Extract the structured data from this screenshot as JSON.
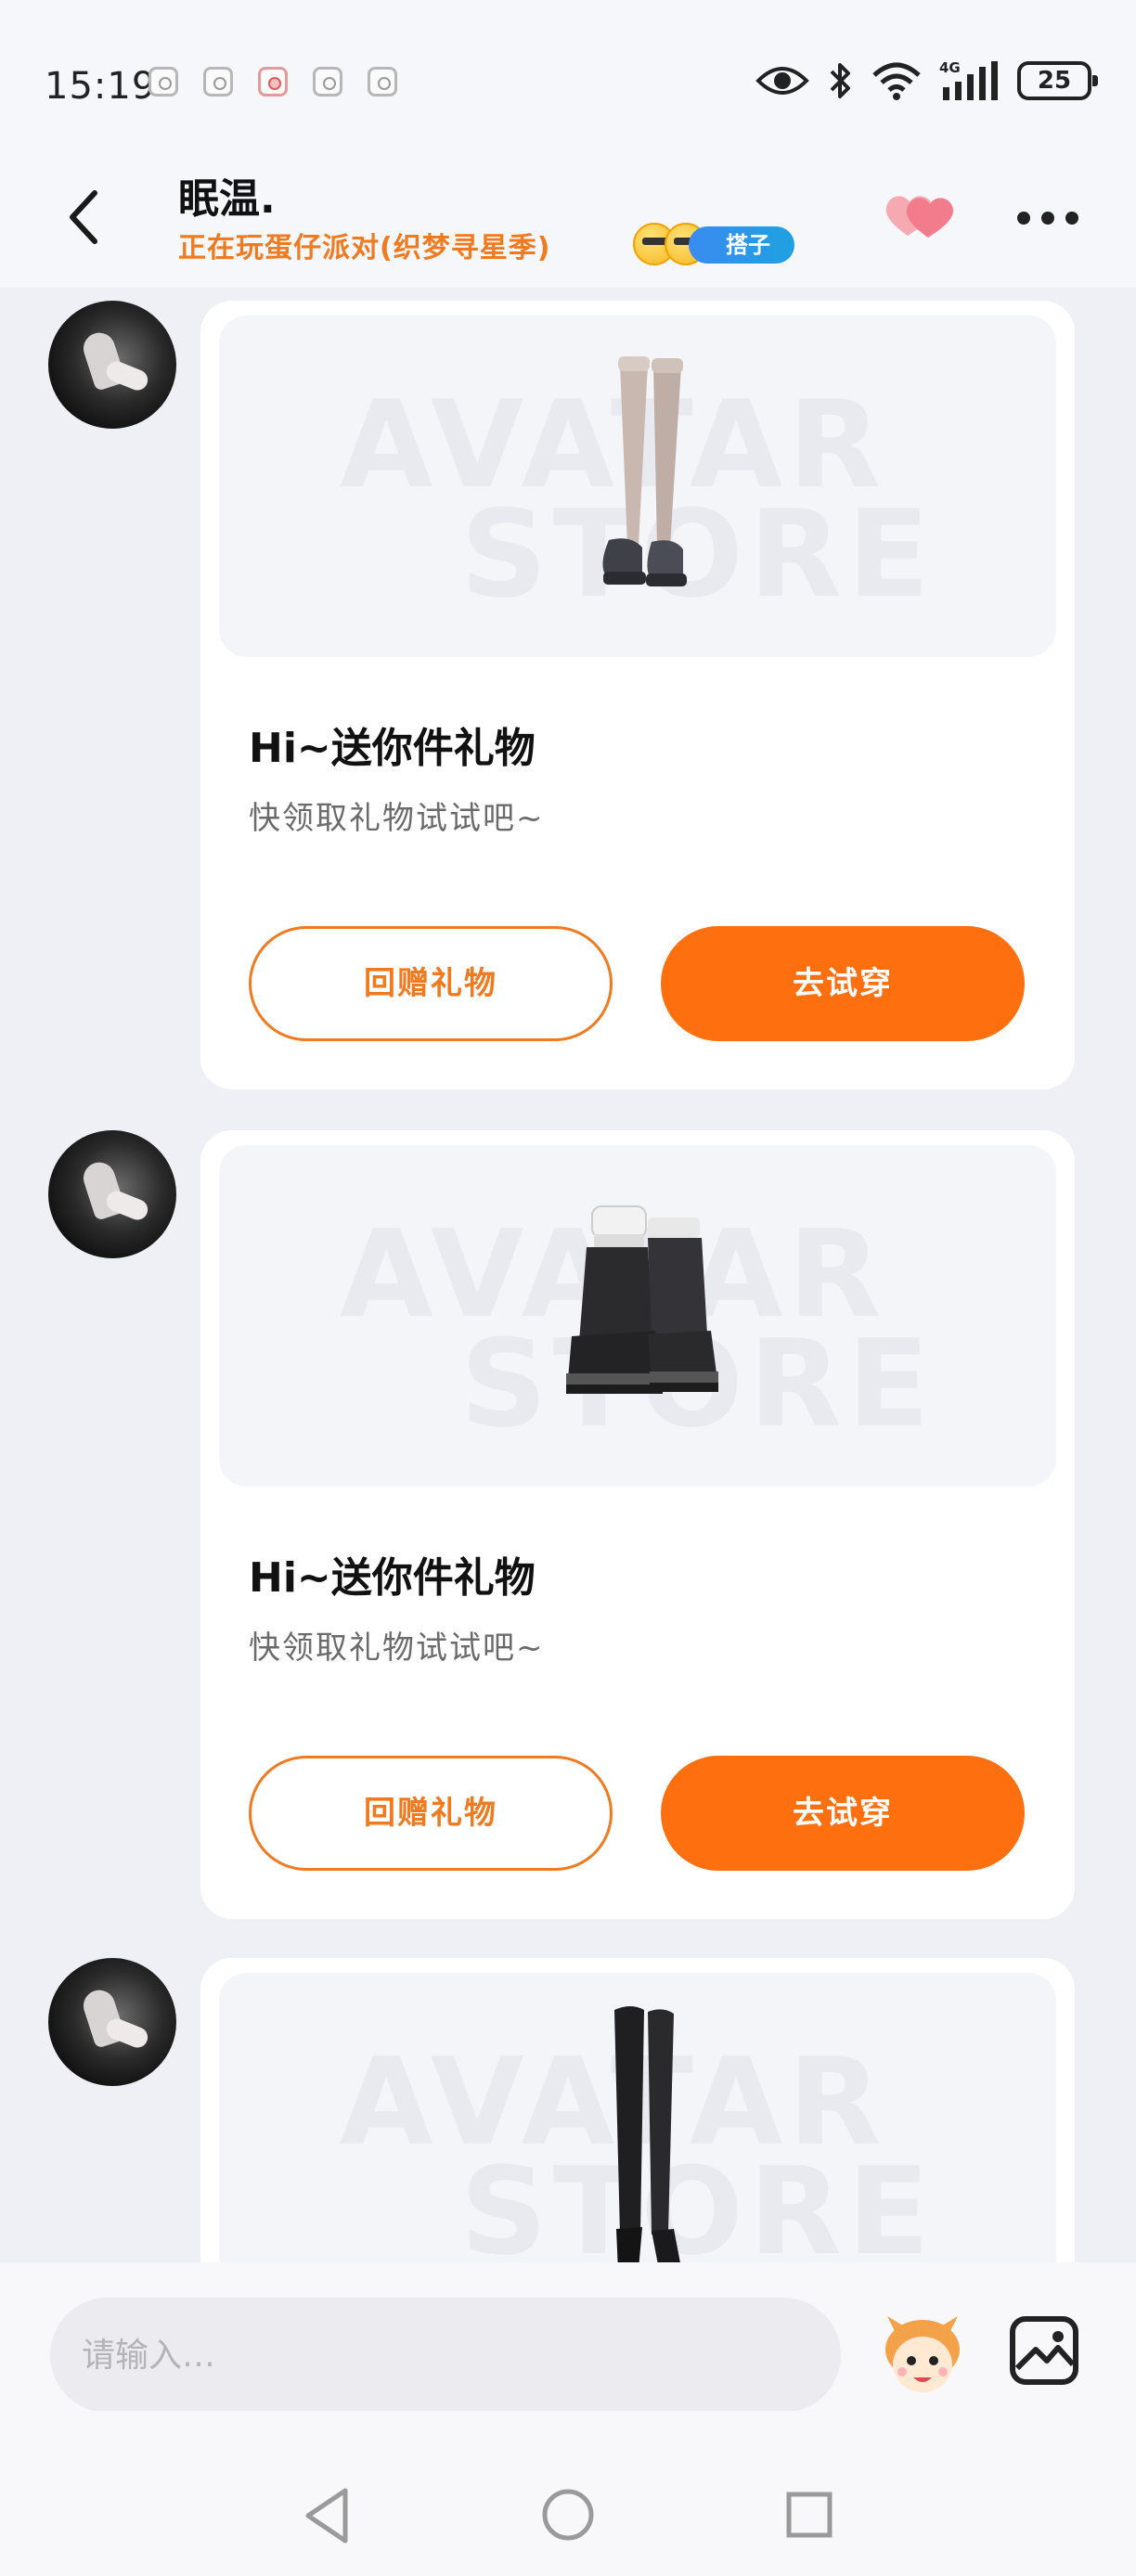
{
  "status_bar": {
    "time": "15:19",
    "network": "4G",
    "battery": "25"
  },
  "header": {
    "name": "眠温.",
    "status": "正在玩蛋仔派对(织梦寻星季)",
    "partner_badge": "搭子"
  },
  "messages": [
    {
      "item": "stockings-shoes",
      "watermark_line1": "AVATAR",
      "watermark_line2": "STORE",
      "title": "Hi~送你件礼物",
      "subtitle": "快领取礼物试试吧~",
      "return_label": "回赠礼物",
      "tryon_label": "去试穿"
    },
    {
      "item": "black-platform-boots",
      "watermark_line1": "AVATAR",
      "watermark_line2": "STORE",
      "title": "Hi~送你件礼物",
      "subtitle": "快领取礼物试试吧~",
      "return_label": "回赠礼物",
      "tryon_label": "去试穿"
    },
    {
      "item": "thigh-high-boots",
      "watermark_line1": "AVATAR",
      "watermark_line2": "STORE"
    }
  ],
  "input_bar": {
    "placeholder": "请输入…"
  },
  "colors": {
    "accent": "#fe6f10",
    "accent_text": "#f07a1f",
    "background": "#eef0f6",
    "card": "#ffffff"
  },
  "icons": [
    "back-arrow-icon",
    "heart-icon",
    "more-icon",
    "sticker-icon",
    "image-icon",
    "nav-back-icon",
    "nav-home-icon",
    "nav-recent-icon"
  ]
}
